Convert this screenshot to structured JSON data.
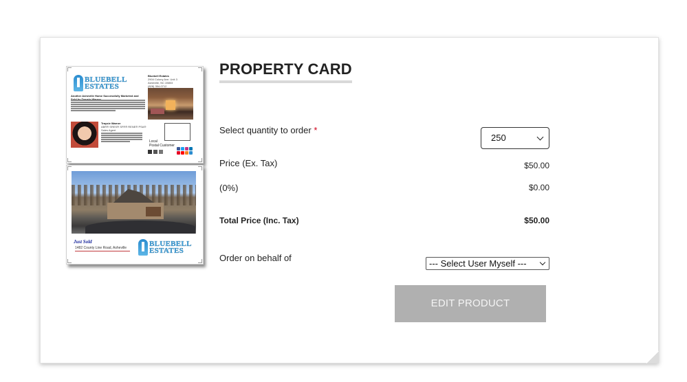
{
  "product": {
    "title": "PROPERTY CARD"
  },
  "preview": {
    "front": {
      "brand_line1": "BLUEBELL",
      "brand_line2": "ESTATES",
      "office_name": "Bluebell Estates",
      "office_address": "2904 Colony Ave. Unit 3",
      "office_city": "Asheville, NC 28803",
      "office_phone": "(828) 354-0712",
      "headline": "Another Asheville Home Successfully Marketed and Sold by Traysie Warner",
      "agent_name": "Traysie Warner",
      "agent_title": "ABR® SRES® SFR® RENE® PSA®",
      "agent_role": "Sales Agent",
      "local_line1": "Local",
      "local_line2": "Postal Customer"
    },
    "back": {
      "just_sold": "Just Sold",
      "address": "1482 County Line Road, Asheville",
      "brand_line1": "BLUEBELL",
      "brand_line2": "ESTATES"
    }
  },
  "form": {
    "quantity_label": "Select quantity to order",
    "required_marker": "*",
    "quantity_value": "250",
    "price_label": "Price (Ex. Tax)",
    "price_value": "$50.00",
    "tax_label": "(0%)",
    "tax_value": "$0.00",
    "total_label": "Total Price (Inc. Tax)",
    "total_value": "$50.00",
    "behalf_label": "Order on behalf of",
    "behalf_value": "--- Select User Myself ---",
    "edit_button": "EDIT PRODUCT"
  },
  "colors": {
    "required": "#d0021b",
    "button_bg": "#b0b0b0",
    "brand_blue": "#4aa6dd"
  }
}
